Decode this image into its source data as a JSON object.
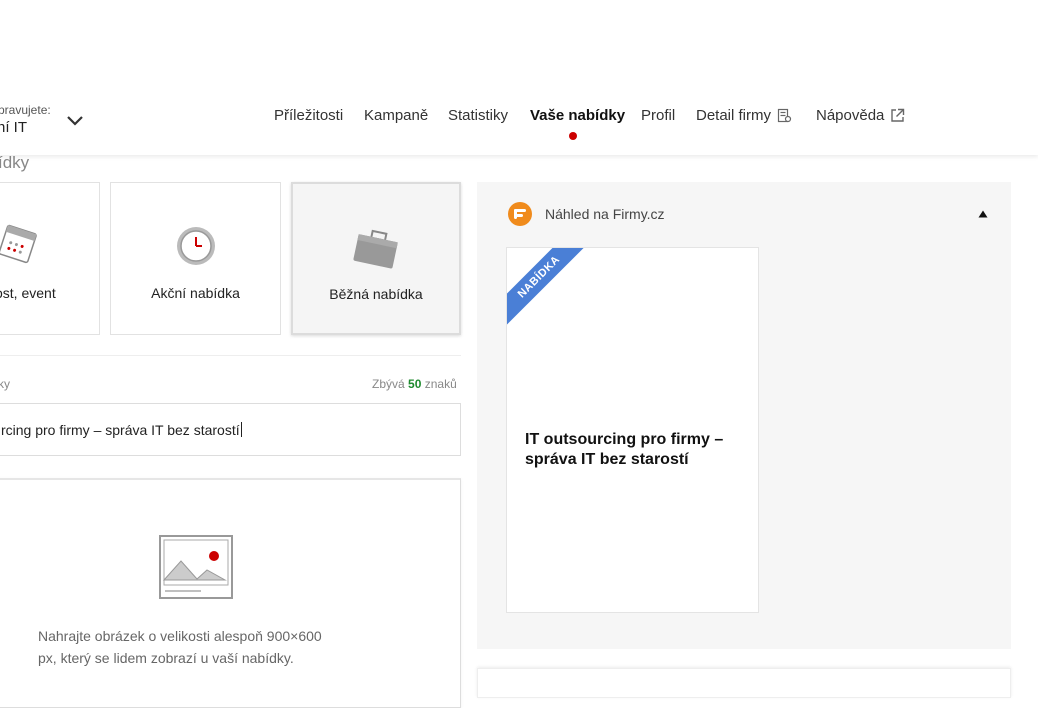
{
  "company_switch": {
    "label": "pravujete:",
    "name": "ní IT"
  },
  "nav": {
    "items": [
      {
        "label": "Příležitosti"
      },
      {
        "label": "Kampaně"
      },
      {
        "label": "Statistiky"
      },
      {
        "label": "Vaše nabídky",
        "active": true
      },
      {
        "label": "Profil"
      },
      {
        "label": "Detail firmy",
        "icon": "building-icon"
      },
      {
        "label": "Nápověda",
        "icon": "external-link-icon"
      }
    ],
    "active_color": "#cc0000"
  },
  "offer_form": {
    "section_heading": "ídky",
    "types": [
      {
        "label": "ost, event",
        "icon": "calendar-icon"
      },
      {
        "label": "Akční nabídka",
        "icon": "clock-icon"
      },
      {
        "label": "Běžná nabídka",
        "icon": "briefcase-icon",
        "selected": true
      }
    ],
    "title_field": {
      "label": "ky",
      "counter_prefix": "Zbývá",
      "counter_value": "50",
      "counter_suffix": "znaků",
      "value": "rcing pro firmy – správa IT bez starostí"
    },
    "upload": {
      "icon": "image-placeholder-icon",
      "text": "Nahrajte obrázek o velikosti alespoň 900×600 px, který se lidem zobrazí u vaší nabídky."
    }
  },
  "preview": {
    "logo_icon": "firmy-logo-icon",
    "title": "Náhled na Firmy.cz",
    "toggle_icon": "triangle-up-icon",
    "card": {
      "ribbon": "NABÍDKA",
      "ribbon_color": "#4a7fd6",
      "title": "IT outsourcing pro firmy – správa IT bez starostí"
    }
  }
}
